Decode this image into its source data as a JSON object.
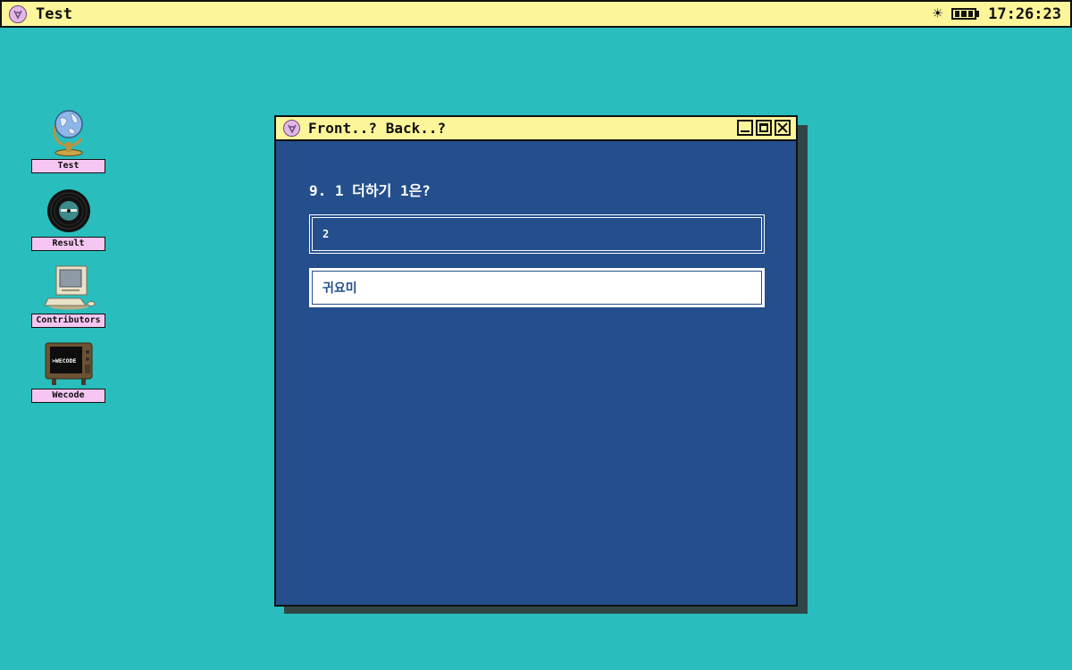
{
  "topbar": {
    "app_name": "Test",
    "clock": "17:26:23",
    "icons": [
      "app-logo-icon",
      "brightness-icon",
      "battery-icon"
    ]
  },
  "desktop": {
    "icons": [
      {
        "label": "Test",
        "icon": "globe-icon"
      },
      {
        "label": "Result",
        "icon": "vinyl-record-icon"
      },
      {
        "label": "Contributors",
        "icon": "computer-icon"
      },
      {
        "label": "Wecode",
        "icon": "tv-icon",
        "screen_text": ">WECODE"
      }
    ]
  },
  "window": {
    "title": "Front..? Back..?",
    "question": "9. 1 더하기 1은?",
    "options": [
      {
        "label": "2",
        "selected": false
      },
      {
        "label": "귀요미",
        "selected": true
      }
    ]
  },
  "colors": {
    "desktop": "#29bdbd",
    "titlebar": "#fdf59a",
    "window": "#244f8c",
    "label": "#f6c6f2"
  }
}
